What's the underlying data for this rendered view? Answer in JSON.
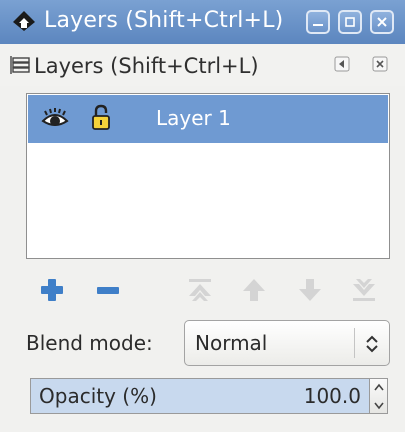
{
  "window": {
    "title": "Layers (Shift+Ctrl+L)",
    "controls": [
      "minimize",
      "maximize",
      "close"
    ]
  },
  "panel": {
    "title": "Layers (Shift+Ctrl+L)",
    "icon": "layers-icon"
  },
  "layers": [
    {
      "name": "Layer 1",
      "visible": true,
      "locked": false,
      "selected": true
    }
  ],
  "toolbar": {
    "buttons": [
      "add-layer",
      "remove-layer",
      "raise-to-top",
      "raise",
      "lower",
      "lower-to-bottom"
    ]
  },
  "blend": {
    "label": "Blend mode:",
    "value": "Normal"
  },
  "opacity": {
    "label": "Opacity (%)",
    "value": "100.0",
    "fraction": 1.0
  },
  "colors": {
    "titlebar": "#6b93c9",
    "selection": "#6f9ad2",
    "add_icon": "#3f7fc8",
    "disabled_icon": "#d4d4d4"
  }
}
